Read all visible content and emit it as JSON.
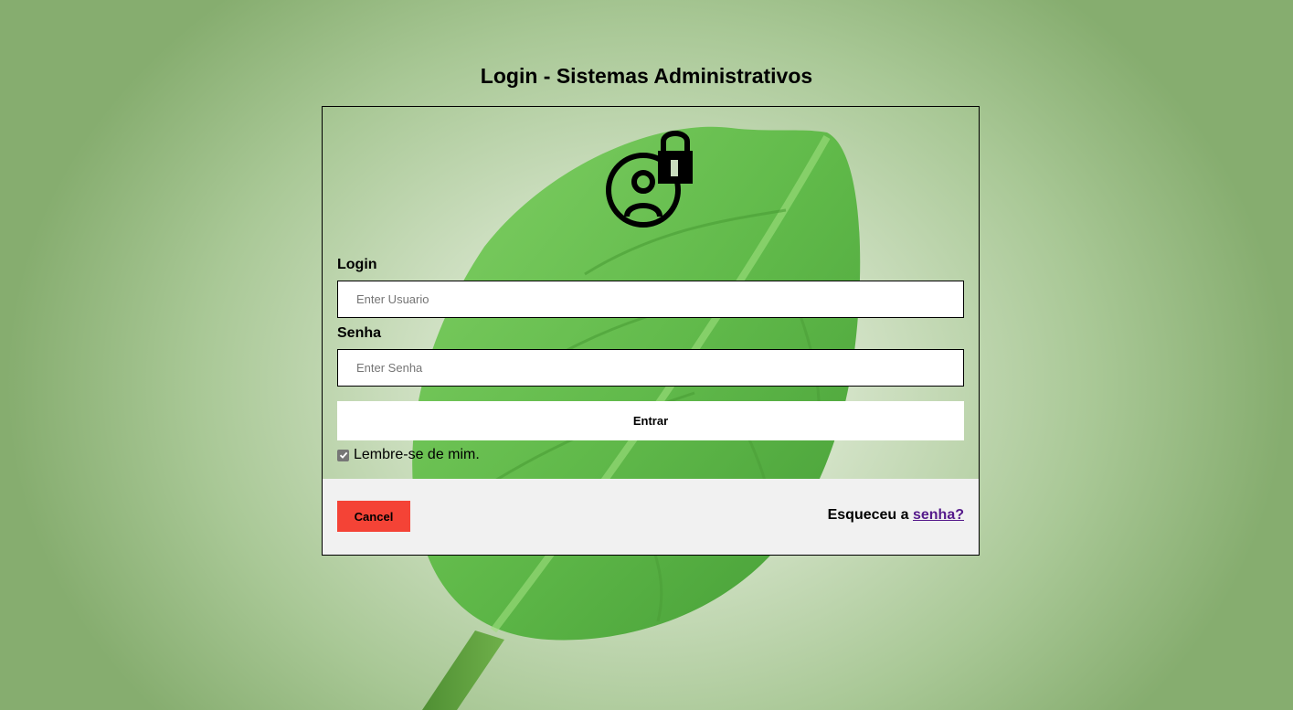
{
  "page": {
    "title": "Login - Sistemas Administrativos"
  },
  "form": {
    "login_label": "Login",
    "username_placeholder": "Enter Usuario",
    "username_value": "",
    "password_label": "Senha",
    "password_placeholder": "Enter Senha",
    "password_value": "",
    "submit_label": "Entrar",
    "remember_label": "Lembre-se de mim.",
    "remember_checked": true
  },
  "footer": {
    "cancel_label": "Cancel",
    "forgot_prefix": "Esqueceu a ",
    "forgot_link": "senha?"
  },
  "icons": {
    "avatar": "user-lock-icon",
    "background": "leaf-illustration"
  },
  "colors": {
    "cancel_button": "#f44336",
    "footer_bg": "#f1f1f1",
    "link": "#551a8b",
    "leaf": "#5cb845"
  }
}
